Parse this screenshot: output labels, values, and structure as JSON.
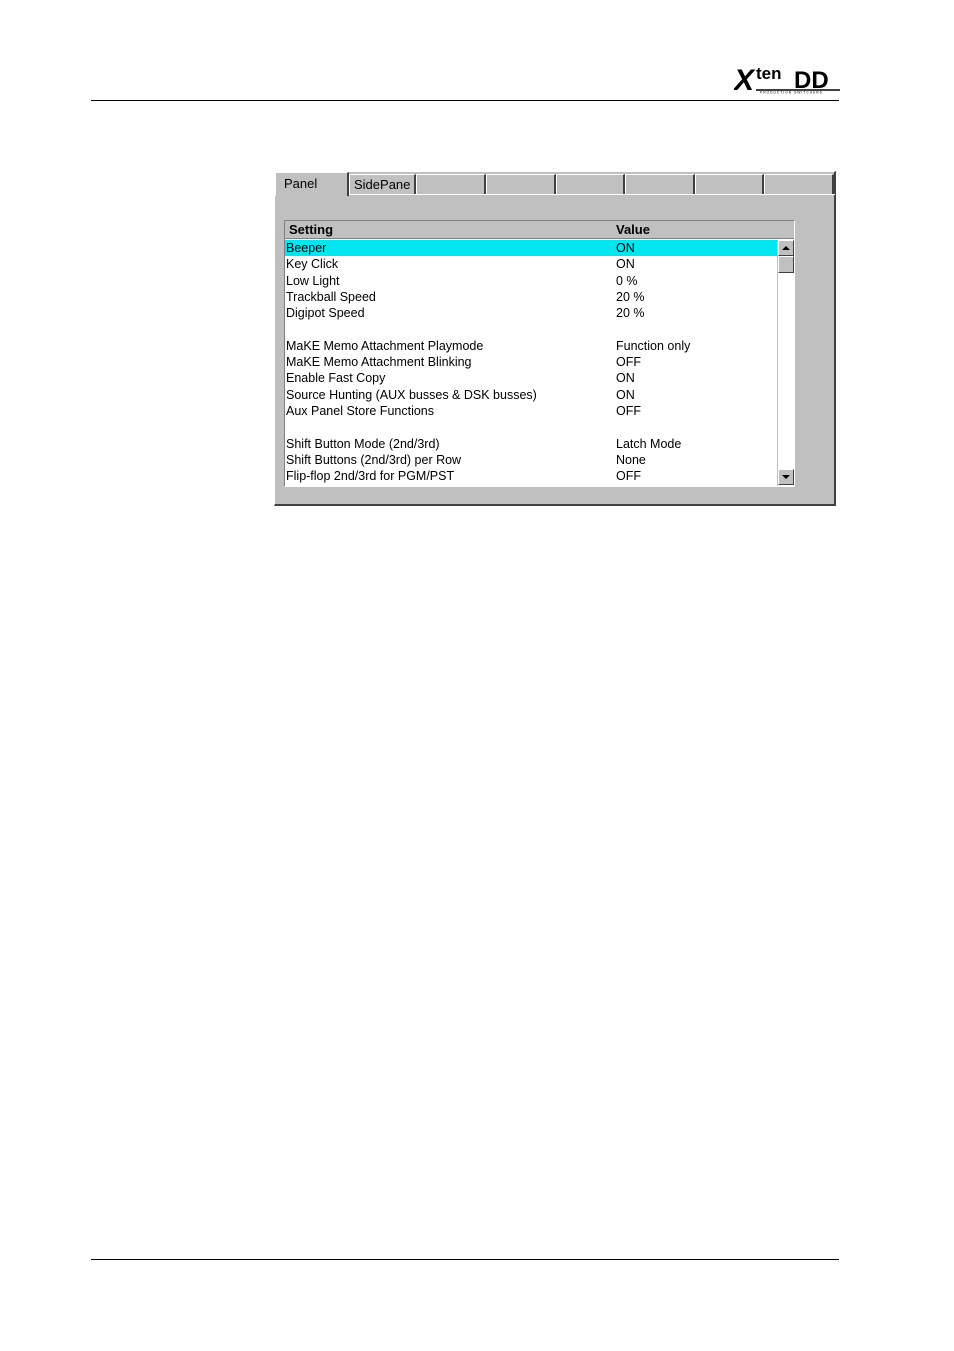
{
  "logo": {
    "text_x": "X",
    "text_ten": "ten",
    "text_dd": "DD",
    "tagline": "PRODUCTION SWITCHERS"
  },
  "dialog": {
    "tabs": [
      {
        "label": "Panel",
        "active": true
      },
      {
        "label": "SidePane",
        "active": false
      },
      {
        "label": "",
        "active": false
      },
      {
        "label": "",
        "active": false
      },
      {
        "label": "",
        "active": false
      },
      {
        "label": "",
        "active": false
      },
      {
        "label": "",
        "active": false
      },
      {
        "label": "",
        "active": false
      }
    ],
    "columns": {
      "setting": "Setting",
      "value": "Value"
    },
    "rows": [
      {
        "setting": "Beeper",
        "value": "ON",
        "selected": true
      },
      {
        "setting": "Key Click",
        "value": "ON"
      },
      {
        "setting": "Low Light",
        "value": "0 %"
      },
      {
        "setting": "Trackball Speed",
        "value": "20 %"
      },
      {
        "setting": "Digipot Speed",
        "value": "20 %"
      },
      {
        "setting": "",
        "value": ""
      },
      {
        "setting": "MaKE Memo Attachment Playmode",
        "value": "Function only"
      },
      {
        "setting": "MaKE Memo Attachment Blinking",
        "value": "OFF"
      },
      {
        "setting": "Enable Fast Copy",
        "value": "ON"
      },
      {
        "setting": "Source Hunting (AUX busses & DSK busses)",
        "value": "ON"
      },
      {
        "setting": "Aux Panel Store Functions",
        "value": "OFF"
      },
      {
        "setting": "",
        "value": ""
      },
      {
        "setting": "Shift Button Mode (2nd/3rd)",
        "value": "Latch Mode"
      },
      {
        "setting": "Shift Buttons (2nd/3rd) per Row",
        "value": "None"
      },
      {
        "setting": "Flip-flop 2nd/3rd for PGM/PST",
        "value": "OFF"
      }
    ]
  },
  "colors": {
    "selection": "#00e5ee",
    "dialog_bg": "#c0c0c0"
  },
  "icons": {
    "scroll_up": "arrow-up-icon",
    "scroll_down": "arrow-down-icon"
  }
}
